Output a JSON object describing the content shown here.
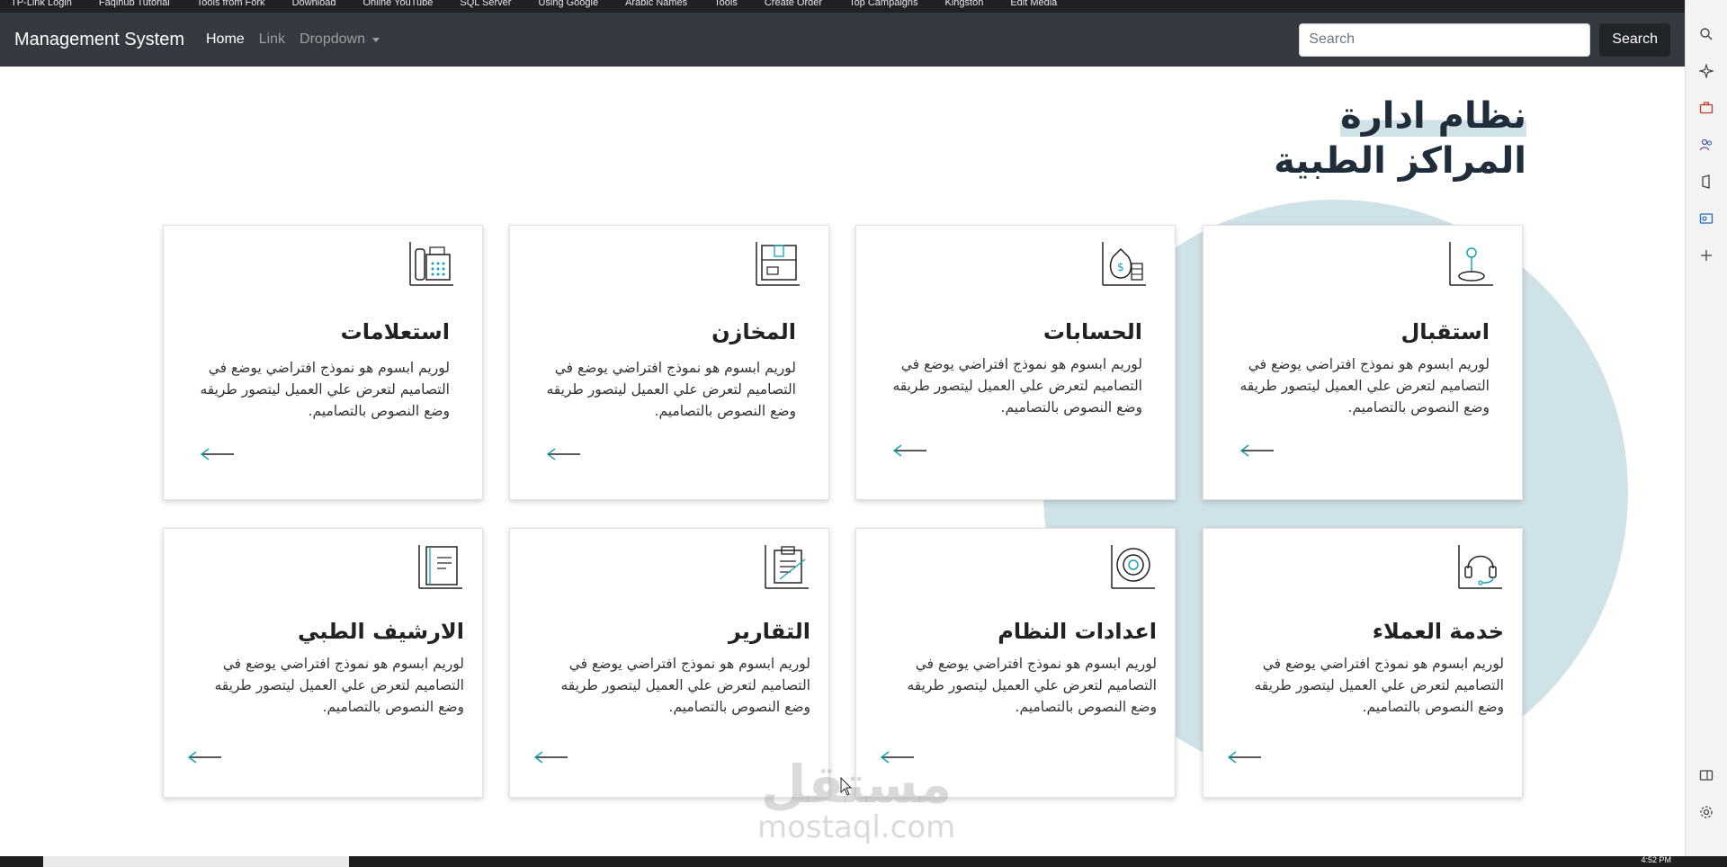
{
  "bookmarks": [
    "TP-Link Login",
    "Faqihub Tutorial",
    "Tools from Fork",
    "Download",
    "Online YouTube",
    "SQL Server",
    "Using Google",
    "Arabic Names",
    "Tools",
    "Create Order",
    "Top Campaigns",
    "Kingston",
    "Edit Media"
  ],
  "navbar": {
    "brand": "Management System",
    "links": [
      {
        "label": "Home",
        "active": true
      },
      {
        "label": "Link",
        "active": false
      },
      {
        "label": "Dropdown",
        "active": false
      }
    ],
    "search_placeholder": "Search",
    "search_button": "Search"
  },
  "hero": {
    "line1": "نظام ادارة",
    "line2": "المراكز الطبية"
  },
  "cards": [
    {
      "title": "استقبال",
      "desc": "لوريم ابسوم هو نموذج افتراضي يوضع في التصاميم لتعرض علي العميل ليتصور طريقه وضع النصوص بالتصاميم.",
      "icon": "reception-icon"
    },
    {
      "title": "الحسابات",
      "desc": "لوريم ابسوم هو نموذج افتراضي يوضع في التصاميم لتعرض علي العميل ليتصور طريقه وضع النصوص بالتصاميم.",
      "icon": "money-bag-icon"
    },
    {
      "title": "المخازن",
      "desc": "لوريم ابسوم هو نموذج افتراضي يوضع في التصاميم لتعرض علي العميل ليتصور طريقه وضع النصوص بالتصاميم.",
      "icon": "warehouse-box-icon"
    },
    {
      "title": "استعلامات",
      "desc": "لوريم ابسوم هو نموذج افتراضي يوضع في التصاميم لتعرض علي العميل ليتصور طريقه وضع النصوص بالتصاميم.",
      "icon": "phone-icon"
    },
    {
      "title": "خدمة العملاء",
      "desc": "لوريم ابسوم هو نموذج افتراضي يوضع في التصاميم لتعرض علي العميل ليتصور طريقه وضع النصوص بالتصاميم.",
      "icon": "headset-icon"
    },
    {
      "title": "اعدادات النظام",
      "desc": "لوريم ابسوم هو نموذج افتراضي يوضع في التصاميم لتعرض علي العميل ليتصور طريقه وضع النصوص بالتصاميم.",
      "icon": "settings-target-icon"
    },
    {
      "title": "التقارير",
      "desc": "لوريم ابسوم هو نموذج افتراضي يوضع في التصاميم لتعرض علي العميل ليتصور طريقه وضع النصوص بالتصاميم.",
      "icon": "clipboard-report-icon"
    },
    {
      "title": "الارشيف الطبي",
      "desc": "لوريم ابسوم هو نموذج افتراضي يوضع في التصاميم لتعرض علي العميل ليتصور طريقه وضع النصوص بالتصاميم.",
      "icon": "notebook-icon"
    }
  ],
  "watermark": {
    "arabic": "مستقل",
    "latin": "mostaql.com"
  },
  "taskbar": {
    "clock": "4:52 PM"
  },
  "colors": {
    "navbar": "#343a40",
    "accent": "#17a2b8",
    "circle": "#cfe2e8"
  }
}
